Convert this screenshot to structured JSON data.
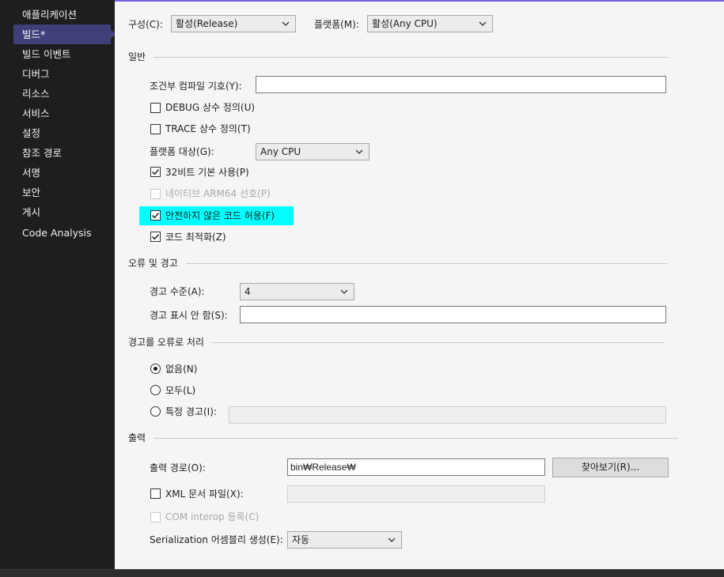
{
  "sidebar": {
    "items": [
      {
        "label": "애플리케이션"
      },
      {
        "label": "빌드*"
      },
      {
        "label": "빌드 이벤트"
      },
      {
        "label": "디버그"
      },
      {
        "label": "리소스"
      },
      {
        "label": "서비스"
      },
      {
        "label": "설정"
      },
      {
        "label": "참조 경로"
      },
      {
        "label": "서명"
      },
      {
        "label": "보안"
      },
      {
        "label": "게시"
      },
      {
        "label": "Code Analysis"
      }
    ],
    "active_index": 1,
    "active_color": "#3f3f7a"
  },
  "header": {
    "configuration_label": "구성(C):",
    "configuration_value": "활성(Release)",
    "platform_label": "플랫폼(M):",
    "platform_value": "활성(Any CPU)"
  },
  "general": {
    "title": "일반",
    "conditional_symbols_label": "조건부 컴파일 기호(Y):",
    "conditional_symbols_value": "",
    "define_debug_label": "DEBUG 상수 정의(U)",
    "define_debug_checked": false,
    "define_trace_label": "TRACE 상수 정의(T)",
    "define_trace_checked": false,
    "platform_target_label": "플랫폼 대상(G):",
    "platform_target_value": "Any CPU",
    "prefer32_label": "32비트 기본 사용(P)",
    "prefer32_checked": true,
    "prefer_arm64_label": "네이티브 ARM64 선호(P)",
    "prefer_arm64_checked": false,
    "prefer_arm64_enabled": false,
    "allow_unsafe_label": "안전하지 않은 코드 허용(F)",
    "allow_unsafe_checked": true,
    "allow_unsafe_highlight": "#00ffff",
    "optimize_label": "코드 최적화(Z)",
    "optimize_checked": true
  },
  "errors": {
    "title": "오류 및 경고",
    "warning_level_label": "경고 수준(A):",
    "warning_level_value": "4",
    "suppress_label": "경고 표시 안 함(S):",
    "suppress_value": ""
  },
  "treat_warnings": {
    "title": "경고를 오류로 처리",
    "none_label": "없음(N)",
    "all_label": "모두(L)",
    "specific_label": "특정 경고(I):",
    "selected": "none",
    "specific_value": ""
  },
  "output": {
    "title": "출력",
    "path_label": "출력 경로(O):",
    "path_value": "bin₩Release₩",
    "browse_label": "찾아보기(R)...",
    "xml_label": "XML 문서 파일(X):",
    "xml_checked": false,
    "xml_value": "",
    "com_label": "COM interop 등록(C)",
    "com_checked": false,
    "com_enabled": false,
    "serialization_label": "Serialization 어셈블리 생성(E):",
    "serialization_value": "자동"
  },
  "colors": {
    "accent": "#7160e8",
    "content_bg": "#f5f5f5",
    "sidebar_bg": "#1e1e1e"
  }
}
